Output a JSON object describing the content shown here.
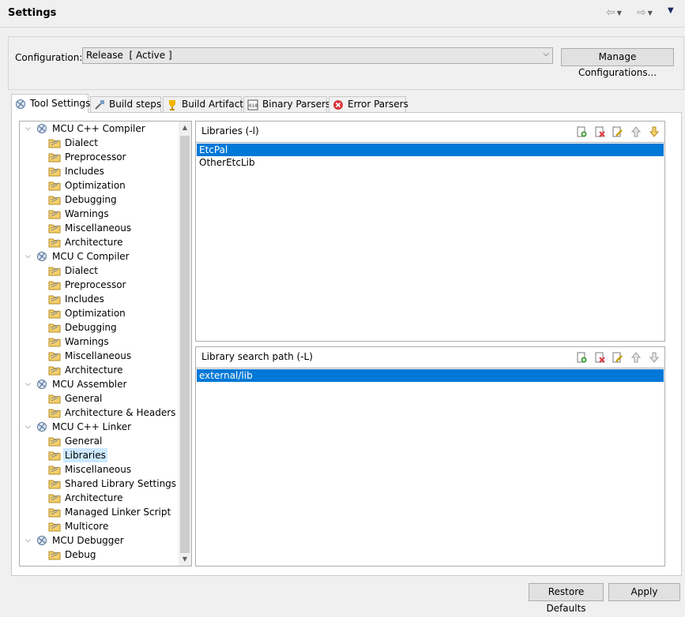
{
  "window": {
    "title": "Settings"
  },
  "config": {
    "label": "Configuration:",
    "value": "Release  [ Active ]",
    "manage_button": "Manage Configurations..."
  },
  "tabs": [
    {
      "label": "Tool Settings",
      "icon": "tool-settings-icon",
      "active": true
    },
    {
      "label": "Build steps",
      "icon": "build-steps-icon",
      "active": false
    },
    {
      "label": "Build Artifact",
      "icon": "build-artifact-icon",
      "active": false
    },
    {
      "label": "Binary Parsers",
      "icon": "binary-parsers-icon",
      "active": false
    },
    {
      "label": "Error Parsers",
      "icon": "error-parsers-icon",
      "active": false
    }
  ],
  "tree": {
    "groups": [
      {
        "label": "MCU C++ Compiler",
        "children": [
          "Dialect",
          "Preprocessor",
          "Includes",
          "Optimization",
          "Debugging",
          "Warnings",
          "Miscellaneous",
          "Architecture"
        ]
      },
      {
        "label": "MCU C Compiler",
        "children": [
          "Dialect",
          "Preprocessor",
          "Includes",
          "Optimization",
          "Debugging",
          "Warnings",
          "Miscellaneous",
          "Architecture"
        ]
      },
      {
        "label": "MCU Assembler",
        "children": [
          "General",
          "Architecture & Headers"
        ]
      },
      {
        "label": "MCU C++ Linker",
        "children": [
          "General",
          "Libraries",
          "Miscellaneous",
          "Shared Library Settings",
          "Architecture",
          "Managed Linker Script",
          "Multicore"
        ]
      },
      {
        "label": "MCU Debugger",
        "children": [
          "Debug"
        ]
      }
    ],
    "selected": "Libraries"
  },
  "libraries": {
    "title": "Libraries (-l)",
    "items": [
      "EtcPal",
      "OtherEtcLib"
    ],
    "selected": "EtcPal"
  },
  "search_path": {
    "title": "Library search path (-L)",
    "items": [
      "external/lib"
    ],
    "selected": "external/lib"
  },
  "tools": [
    "add-icon",
    "delete-icon",
    "edit-icon",
    "move-up-icon",
    "move-down-icon"
  ],
  "footer": {
    "restore_defaults": "Restore Defaults",
    "apply": "Apply"
  },
  "colors": {
    "selection": "#0078d7",
    "tree_selection": "#cce8ff"
  }
}
